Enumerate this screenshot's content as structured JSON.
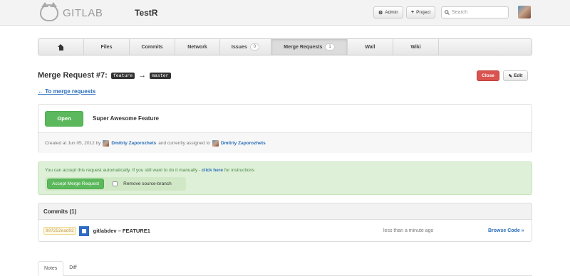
{
  "header": {
    "brand": "GITLAB",
    "project": "TestR",
    "admin_label": "Admin",
    "new_project_label": "Project",
    "search_placeholder": "Search"
  },
  "nav": {
    "items": [
      {
        "label": "",
        "icon": "home-icon"
      },
      {
        "label": "Files"
      },
      {
        "label": "Commits"
      },
      {
        "label": "Network"
      },
      {
        "label": "Issues",
        "badge": "0"
      },
      {
        "label": "Merge Requests",
        "badge": "1",
        "active": true
      },
      {
        "label": "Wall"
      },
      {
        "label": "Wiki"
      }
    ]
  },
  "merge_request": {
    "title": "Merge Request #7:",
    "source_branch": "feature",
    "target_branch": "master",
    "close_label": "Close",
    "edit_label": "Edit",
    "back_link": "← To merge requests",
    "status": "Open",
    "name": "Super Awesome Feature",
    "created_text": "Created at Jun 05, 2012 by",
    "author": "Dmitriy Zaporozhets",
    "assigned_text": "and currently assigned to",
    "assignee": "Dmitriy Zaporozhets"
  },
  "accept": {
    "notice": "You can accept this request automatically. If you still want to do it manually -",
    "click_here": "click here",
    "notice_tail": "for instructions",
    "button_label": "Accept Merge Request",
    "remove_branch_label": "Remove source-branch"
  },
  "commits": {
    "heading": "Commits (1)",
    "rows": [
      {
        "sha": "997252ead02",
        "message": "gitlabdev – FEATURE1",
        "time": "less than a minute ago",
        "browse": "Browse Code »"
      }
    ]
  },
  "tabs": [
    {
      "label": "Notes",
      "active": true
    },
    {
      "label": "Diff"
    }
  ],
  "colors": {
    "accent_link": "#2a6ebb",
    "open_green": "#5cb85c",
    "close_red": "#d9534f",
    "success_bg": "#dff0d8"
  }
}
